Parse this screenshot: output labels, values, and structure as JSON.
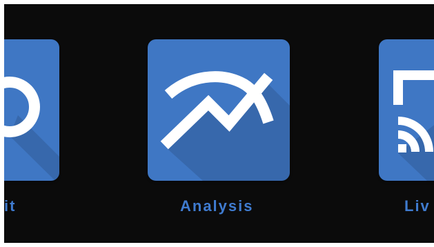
{
  "launcher": {
    "apps": [
      {
        "id": "left",
        "label": "it",
        "icon": "circle-icon"
      },
      {
        "id": "center",
        "label": "Analysis",
        "icon": "analysis-chart-icon"
      },
      {
        "id": "right",
        "label": "Liv",
        "icon": "cast-icon"
      }
    ]
  },
  "colors": {
    "background": "#0b0b0b",
    "tile": "#3f77c4",
    "label": "#3f7bcf",
    "glyph": "#ffffff"
  }
}
